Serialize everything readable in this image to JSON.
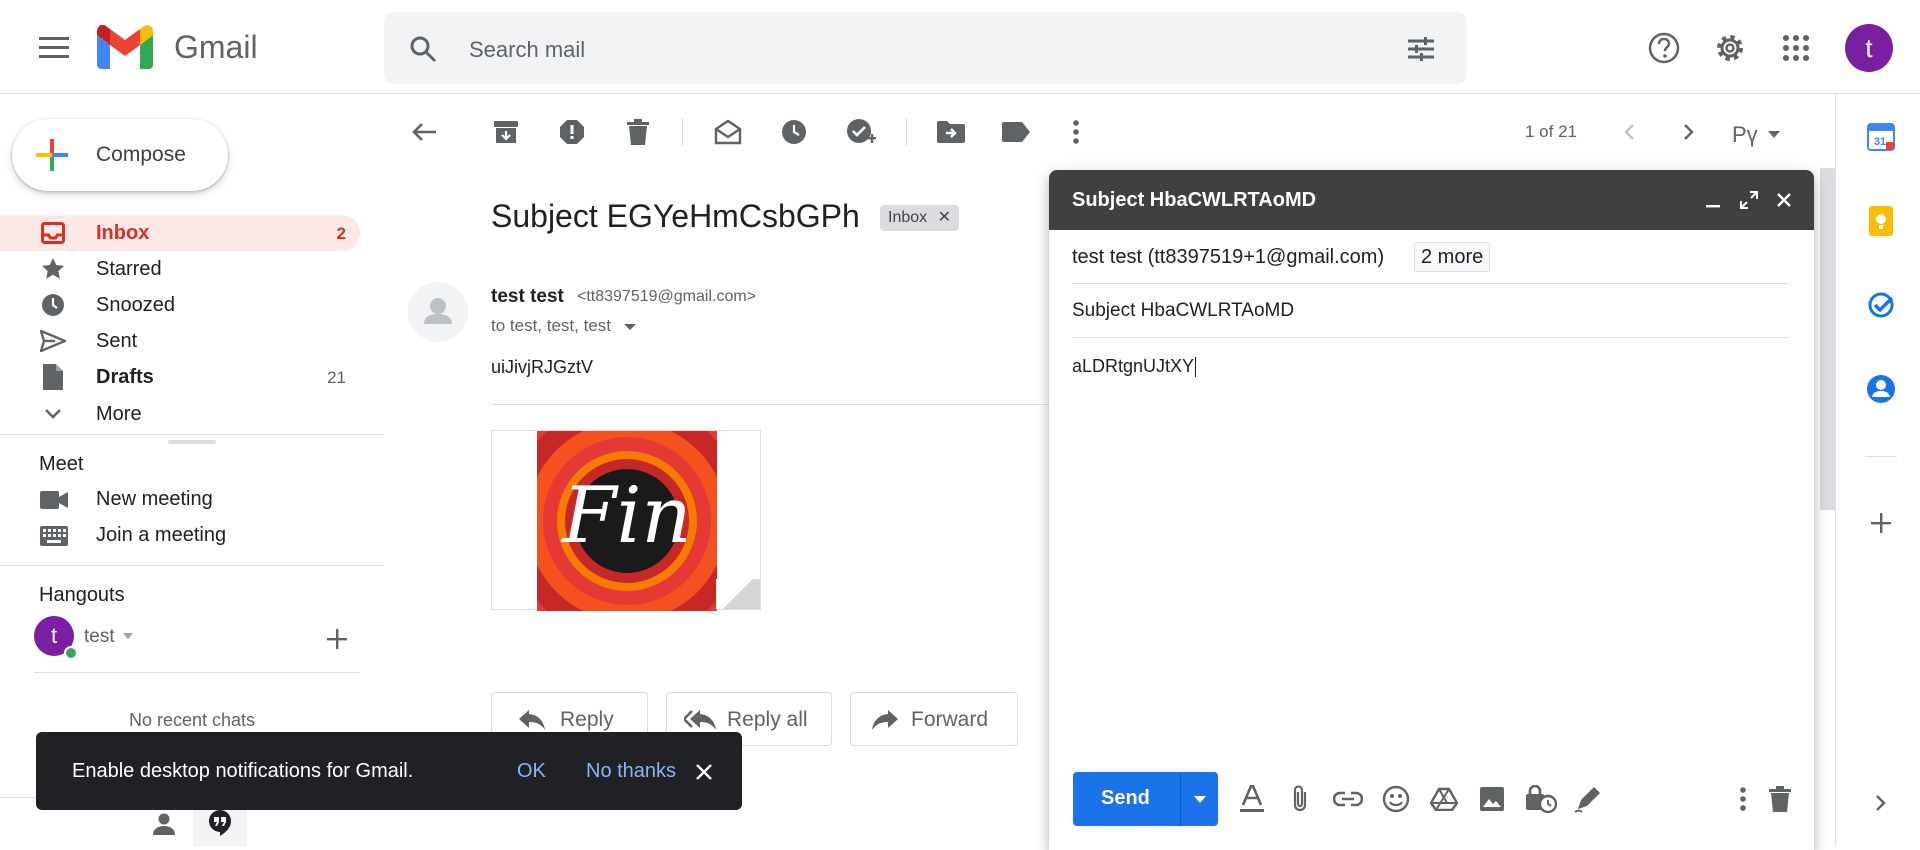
{
  "header": {
    "app_name": "Gmail",
    "search_placeholder": "Search mail",
    "avatar_letter": "t"
  },
  "sidebar": {
    "compose_label": "Compose",
    "items": [
      {
        "label": "Inbox",
        "count": "2",
        "icon": "inbox-icon"
      },
      {
        "label": "Starred",
        "count": "",
        "icon": "star-icon"
      },
      {
        "label": "Snoozed",
        "count": "",
        "icon": "clock-icon"
      },
      {
        "label": "Sent",
        "count": "",
        "icon": "send-icon"
      },
      {
        "label": "Drafts",
        "count": "21",
        "icon": "draft-icon"
      },
      {
        "label": "More",
        "count": "",
        "icon": "chevron-down-icon"
      }
    ],
    "meet": {
      "heading": "Meet",
      "new_meeting": "New meeting",
      "join_meeting": "Join a meeting"
    },
    "hangouts": {
      "heading": "Hangouts",
      "user_letter": "t",
      "user_name": "test",
      "no_chats": "No recent chats"
    }
  },
  "toolbar": {
    "pagination": "1 of 21",
    "input_tool": "Рү"
  },
  "message": {
    "subject": "Subject EGYeHmCsbGPh",
    "label_chip": "Inbox",
    "sender_name": "test test",
    "sender_email": "<tt8397519@gmail.com>",
    "to_line": "to test, test, test",
    "body": "uiJivjRJGztV",
    "attachment_text": "Fin",
    "reply_label": "Reply",
    "reply_all_label": "Reply all",
    "forward_label": "Forward"
  },
  "compose_window": {
    "title": "Subject HbaCWLRTAoMD",
    "to": "test test (tt8397519+1@gmail.com)",
    "more_recipients": "2 more",
    "subject": "Subject HbaCWLRTAoMD",
    "body": "aLDRtgnUJtXY",
    "send_label": "Send"
  },
  "notification": {
    "message": "Enable desktop notifications for Gmail.",
    "ok_label": "OK",
    "no_thanks_label": "No thanks"
  },
  "colors": {
    "accent_blue": "#1a73e8",
    "inbox_red": "#d93025",
    "avatar_purple": "#7b1fa2",
    "selected_bg": "#fce8e6"
  }
}
